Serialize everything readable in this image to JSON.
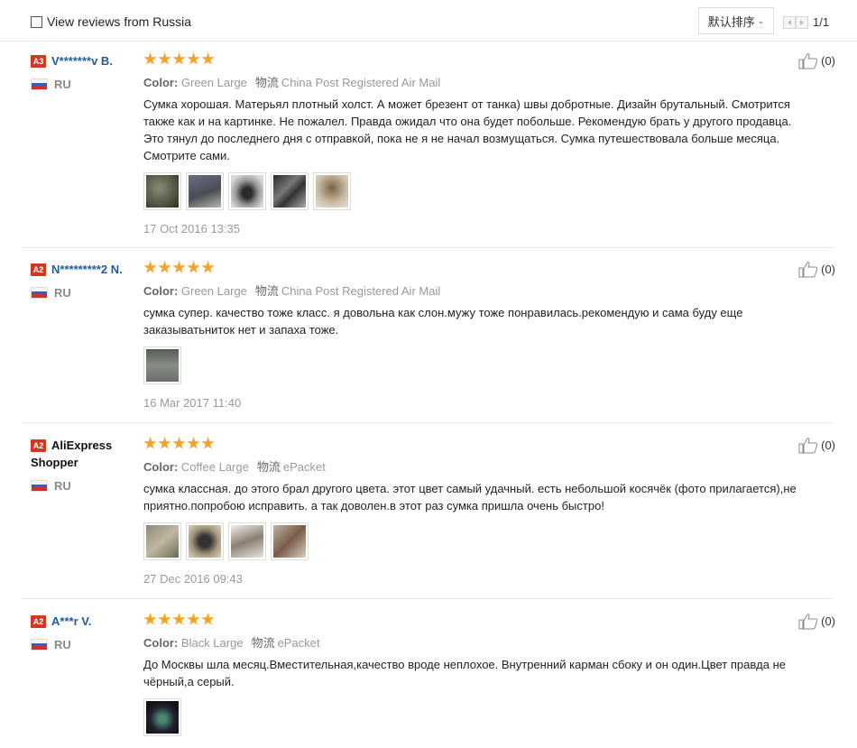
{
  "toolbar": {
    "filter_label": "View reviews from Russia",
    "sort_label": "默认排序",
    "page_indicator": "1/1"
  },
  "reviews": [
    {
      "level": "A3",
      "name": "V*******v B.",
      "country": "RU",
      "color_label": "Color:",
      "color": "Green Large",
      "shipping_label": "物流",
      "shipping": "China Post Registered Air Mail",
      "rating": 5,
      "text": "Сумка хорошая. Матерьял плотный холст. А может брезент от танка) швы добротные. Дизайн брутальный. Смотрится также как и на картинке. Не пожалел. Правда ожидал что она будет побольше. Рекомендую брать у другого продавца. Это тянул до последнего дня с отправкой, пока не я не начал возмущаться. Сумка путешествовала больше месяца. Смотрите сами.",
      "date": "17 Oct 2016 13:35",
      "likes": "(0)"
    },
    {
      "level": "A2",
      "name": "N*********2 N.",
      "country": "RU",
      "color_label": "Color:",
      "color": "Green Large",
      "shipping_label": "物流",
      "shipping": "China Post Registered Air Mail",
      "rating": 5,
      "text": "сумка супер. качество тоже класс. я довольна как слон.мужу тоже понравилась.рекомендую и сама буду еще заказыватьниток нет и запаха тоже.",
      "date": "16 Mar 2017 11:40",
      "likes": "(0)"
    },
    {
      "level": "A2",
      "name": "AliExpress Shopper",
      "country": "RU",
      "color_label": "Color:",
      "color": "Coffee Large",
      "shipping_label": "物流",
      "shipping": "ePacket",
      "rating": 5,
      "text": "сумка классная. до этого брал другого цвета. этот цвет самый удачный. есть небольшой косячёк (фото прилагается),не приятно.попробою исправить. а так доволен.в этот раз сумка пришла очень быстро!",
      "date": "27 Dec 2016 09:43",
      "likes": "(0)"
    },
    {
      "level": "A2",
      "name": "A***r V.",
      "country": "RU",
      "color_label": "Color:",
      "color": "Black Large",
      "shipping_label": "物流",
      "shipping": "ePacket",
      "rating": 5,
      "text": "До Москвы шла месяц.Вместительная,качество вроде неплохое. Внутренний карман сбоку и он один.Цвет правда не чёрный,а серый.",
      "date": "",
      "likes": "(0)"
    }
  ]
}
